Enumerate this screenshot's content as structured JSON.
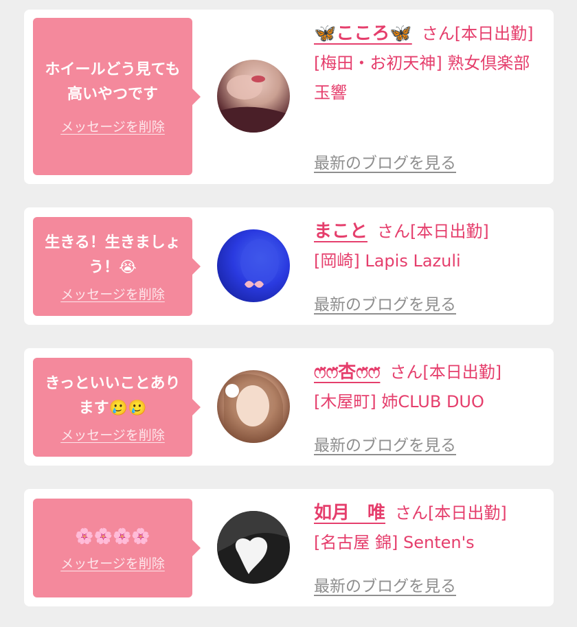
{
  "entries": [
    {
      "message": "ホイールどう見ても高いやつです",
      "delete_label": "メッセージを削除",
      "name": "🦋こころ🦋",
      "san_status": "さん[本日出勤]",
      "shop": "[梅田・お初天神] 熟女倶楽部 玉響",
      "blog_link": "最新のブログを見る"
    },
    {
      "message": "生きる！生きましょう！😭",
      "delete_label": "メッセージを削除",
      "name": "まこと",
      "san_status": "さん[本日出勤]",
      "shop": "[岡崎] Lapis Lazuli",
      "blog_link": "最新のブログを見る"
    },
    {
      "message": "きっといいことあります🥲🥲",
      "delete_label": "メッセージを削除",
      "name": "ෆ̈ෆ̈杏ෆ̈ෆ̈",
      "san_status": "さん[本日出勤]",
      "shop": "[木屋町] 姉CLUB DUO",
      "blog_link": "最新のブログを見る"
    },
    {
      "message": "🌸🌸🌸🌸",
      "delete_label": "メッセージを削除",
      "name": "如月　唯",
      "san_status": "さん[本日出勤]",
      "shop": "[名古屋 錦] Senten's",
      "blog_link": "最新のブログを見る"
    }
  ],
  "colors": {
    "accent": "#e53e6c",
    "bubble": "#f4899c",
    "link_gray": "#8e8e8e",
    "background": "#eeeeee"
  }
}
